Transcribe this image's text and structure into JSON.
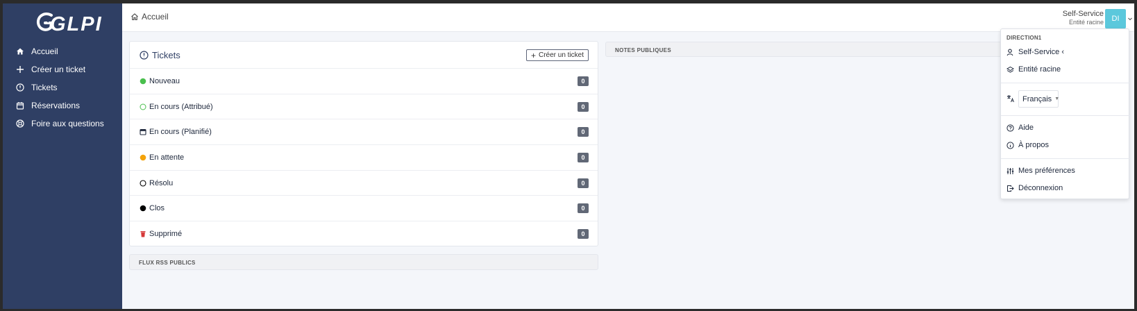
{
  "app": {
    "logo": "GLPI"
  },
  "sidebar": {
    "items": [
      {
        "label": "Accueil",
        "icon": "home-icon"
      },
      {
        "label": "Créer un ticket",
        "icon": "plus-icon"
      },
      {
        "label": "Tickets",
        "icon": "alert-circle-icon"
      },
      {
        "label": "Réservations",
        "icon": "calendar-icon"
      },
      {
        "label": "Foire aux questions",
        "icon": "help-globe-icon"
      }
    ]
  },
  "header": {
    "breadcrumb": "Accueil",
    "profile": "Self-Service",
    "entity": "Entité racine",
    "avatar_initials": "DI"
  },
  "tickets": {
    "title": "Tickets",
    "create_button": "Créer un ticket",
    "statuses": [
      {
        "label": "Nouveau",
        "count": "0",
        "icon": "new-dot-icon",
        "color": "#49bf4d"
      },
      {
        "label": "En cours (Attribué)",
        "count": "0",
        "icon": "assigned-circle-icon",
        "color": "#49bf4d"
      },
      {
        "label": "En cours (Planifié)",
        "count": "0",
        "icon": "planned-calendar-icon",
        "color": "#1d273b"
      },
      {
        "label": "En attente",
        "count": "0",
        "icon": "waiting-dot-icon",
        "color": "#f4a30a"
      },
      {
        "label": "Résolu",
        "count": "0",
        "icon": "solved-circle-icon",
        "color": "#000000"
      },
      {
        "label": "Clos",
        "count": "0",
        "icon": "closed-dot-icon",
        "color": "#000000"
      },
      {
        "label": "Supprimé",
        "count": "0",
        "icon": "trash-icon",
        "color": "#d63939"
      }
    ]
  },
  "panels": {
    "rss": "FLUX RSS PUBLICS",
    "notes": "NOTES PUBLIQUES"
  },
  "dropdown": {
    "header": "DIRECTION1",
    "profile": "Self-Service ‹",
    "entity": "Entité racine",
    "language": "Français",
    "help": "Aide",
    "about": "À propos",
    "preferences": "Mes préférences",
    "logout": "Déconnexion"
  },
  "colors": {
    "sidebar": "#2f3f64",
    "avatar": "#5bc8dc",
    "badge": "#616876"
  }
}
